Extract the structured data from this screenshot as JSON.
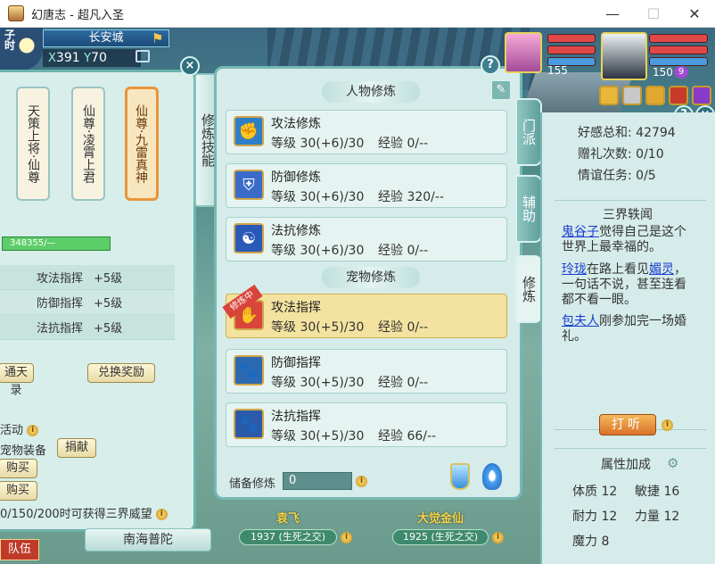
{
  "window": {
    "title": "幻唐志 - 超凡入圣",
    "min_label": "—",
    "max_label": "☐",
    "close_label": "✕"
  },
  "location": {
    "time_char": "子\n时",
    "city": "长安城",
    "x_label": "X",
    "x": "391",
    "y_label": "Y",
    "y": "70"
  },
  "left_panel": {
    "titles": [
      "天策上将·仙尊",
      "仙尊·凌霄上君",
      "仙尊·九雷真神"
    ],
    "progress_text": "348355/—",
    "rows": [
      {
        "name": "攻法指挥",
        "value": "+5级"
      },
      {
        "name": "防御指挥",
        "value": "+5级"
      },
      {
        "name": "法抗指挥",
        "value": "+5级"
      }
    ],
    "btn_tianlu": "通天录",
    "btn_exchange": "兑换奖励",
    "event_label": "活动",
    "equip_label": "宠物装备",
    "btn_donate": "捐献",
    "btn_buy1": "购买",
    "btn_buy2": "购买",
    "note": "0/150/200时可获得三界威望",
    "close": "×"
  },
  "side_label": "修炼技能",
  "center_panel": {
    "char_header": "人物修炼",
    "pet_header": "宠物修炼",
    "char_items": [
      {
        "name": "攻法修炼",
        "level": "等级 30(+6)/30",
        "exp": "经验 0/--"
      },
      {
        "name": "防御修炼",
        "level": "等级 30(+6)/30",
        "exp": "经验 320/--"
      },
      {
        "name": "法抗修炼",
        "level": "等级 30(+6)/30",
        "exp": "经验 0/--"
      }
    ],
    "pet_items": [
      {
        "name": "攻法指挥",
        "level": "等级 30(+5)/30",
        "exp": "经验 0/--",
        "badge": "修炼中"
      },
      {
        "name": "防御指挥",
        "level": "等级 30(+5)/30",
        "exp": "经验 0/--"
      },
      {
        "name": "法抗指挥",
        "level": "等级 30(+5)/30",
        "exp": "经验 66/--"
      }
    ],
    "reserve_label": "储备修炼",
    "reserve_value": "0",
    "help": "?",
    "close": "×"
  },
  "right_tabs": [
    "门派",
    "辅助",
    "修炼"
  ],
  "party": {
    "pet_level": "155",
    "player_level": "150",
    "player_badge": "9"
  },
  "right_panel": {
    "favor_label": "好感总和:",
    "favor_value": "42794",
    "gift_label": "赠礼次数:",
    "gift_value": "0/10",
    "quest_label": "情谊任务:",
    "quest_value": "0/5",
    "news_title": "三界轶闻",
    "news": [
      {
        "who": "鬼谷子",
        "text": "觉得自己是这个世界上最幸福的。"
      },
      {
        "who": "玲珑",
        "mid": "在路上看见",
        "who2": "媚灵",
        "text": "，一句话不说，甚至连看都不看一眼。"
      },
      {
        "who": "包夫人",
        "text": "刚参加完一场婚礼。"
      }
    ],
    "listen_btn": "打听",
    "attr_title": "属性加成",
    "attrs": [
      {
        "name": "体质",
        "value": "12"
      },
      {
        "name": "敏捷",
        "value": "16"
      },
      {
        "name": "耐力",
        "value": "12"
      },
      {
        "name": "力量",
        "value": "12"
      },
      {
        "name": "魔力",
        "value": "8"
      }
    ]
  },
  "bottom": {
    "pet1_name": "袁飞",
    "pet1_bar": "1937 (生死之交)",
    "pet2_name": "大觉金仙",
    "pet2_bar": "1925 (生死之交)",
    "map_btn": "南海普陀",
    "team_btn": "队伍"
  }
}
